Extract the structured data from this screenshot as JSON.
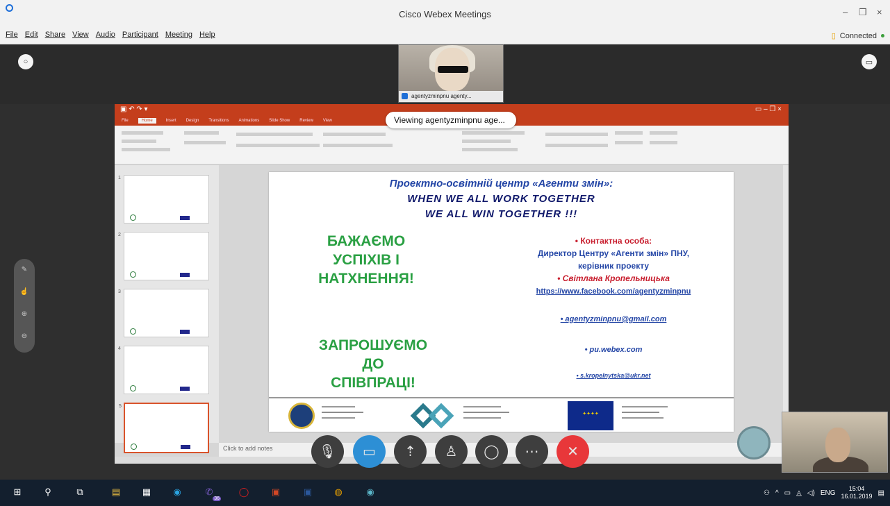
{
  "window": {
    "title": "Cisco Webex Meetings",
    "min": "–",
    "max": "❐",
    "close": "×"
  },
  "menu": [
    "File",
    "Edit",
    "Share",
    "View",
    "Audio",
    "Participant",
    "Meeting",
    "Help"
  ],
  "connection": {
    "label": "Connected"
  },
  "presenter": {
    "caption": "agentyzminpnu agenty..."
  },
  "viewing": "Viewing agentyzminpnu age...",
  "ppt": {
    "tabs": [
      "File",
      "Home",
      "Insert",
      "Design",
      "Transitions",
      "Animations",
      "Slide Show",
      "Review",
      "View"
    ],
    "notes_placeholder": "Click to add notes",
    "thumb_numbers": [
      "1",
      "2",
      "3",
      "4",
      "5"
    ]
  },
  "slide": {
    "title_line1": "Проектно-освітній центр «Агенти змін»:",
    "title_line2": "WHEN WE ALL WORK TOGETHER",
    "title_line3": "WE ALL WIN TOGETHER !!!",
    "left_top": [
      "БАЖАЄМО",
      "УСПІХІВ І",
      "НАТХНЕННЯ!"
    ],
    "left_bottom": [
      "ЗАПРОШУЄМО",
      "ДО",
      "СПІВПРАЦІ!"
    ],
    "contact_label": "• Контактна особа:",
    "contact_role1": "Директор Центру «Агенти змін» ПНУ,",
    "contact_role2": "керівник проекту",
    "contact_name": "• Світлана Кропельницька",
    "facebook": "https://www.facebook.com/agentyzminpnu",
    "email": "• agentyzminpnu@gmail.com",
    "webex": "• pu.webex.com",
    "email2": "• s.kropelnytska@ukr.net"
  },
  "taskbar": {
    "lang": "ENG",
    "time": "15:04",
    "date": "16.01.2019",
    "badge": "36"
  },
  "colors": {
    "ppt_red": "#c43e1c",
    "end_red": "#e8373a",
    "video_blue": "#2d8fd5"
  }
}
